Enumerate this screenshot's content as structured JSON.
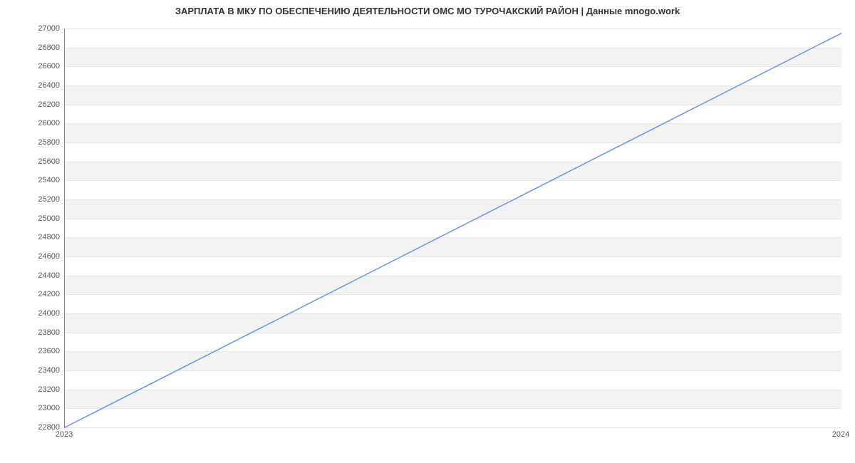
{
  "chart_data": {
    "type": "line",
    "title": "ЗАРПЛАТА В МКУ ПО ОБЕСПЕЧЕНИЮ ДЕЯТЕЛЬНОСТИ ОМС МО ТУРОЧАКСКИЙ РАЙОН | Данные mnogo.work",
    "xlabel": "",
    "ylabel": "",
    "x": [
      "2023",
      "2024"
    ],
    "x_numeric": [
      2023,
      2024
    ],
    "series": [
      {
        "name": "Зарплата",
        "values": [
          22800,
          26950
        ]
      }
    ],
    "ylim": [
      22800,
      27000
    ],
    "yticks": [
      22800,
      23000,
      23200,
      23400,
      23600,
      23800,
      24000,
      24200,
      24400,
      24600,
      24800,
      25000,
      25200,
      25400,
      25600,
      25800,
      26000,
      26200,
      26400,
      26600,
      26800,
      27000
    ],
    "ytick_labels": [
      "22800",
      "23000",
      "23200",
      "23400",
      "23600",
      "23800",
      "24000",
      "24200",
      "24400",
      "24600",
      "24800",
      "25000",
      "25200",
      "25400",
      "25600",
      "25800",
      "26000",
      "26200",
      "26400",
      "26600",
      "26800",
      "27000"
    ],
    "xtick_labels": [
      "2023",
      "2024"
    ],
    "grid": true,
    "colors": {
      "line": "#6495ED",
      "band": "#f3f3f3"
    }
  }
}
